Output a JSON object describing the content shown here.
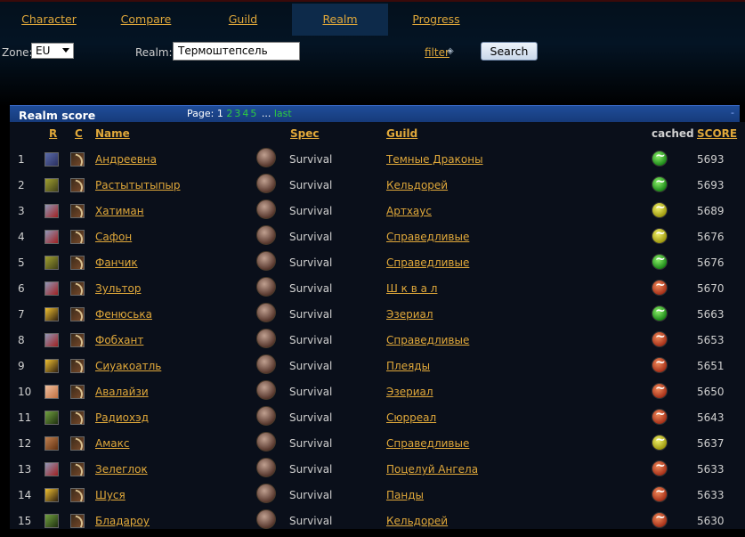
{
  "tabs": [
    {
      "label": "Character"
    },
    {
      "label": "Compare"
    },
    {
      "label": "Guild"
    },
    {
      "label": "Realm",
      "active": true
    },
    {
      "label": "Progress"
    }
  ],
  "search": {
    "zone_label": "Zone:",
    "zone_value": "EU",
    "realm_label": "Realm:",
    "realm_value": "Термоштепсель",
    "filter_label": "filter",
    "button_label": "Search"
  },
  "panel": {
    "title": "Realm score",
    "page_label": "Page:",
    "current_page": "1",
    "pages": [
      "2",
      "3",
      "4",
      "5"
    ],
    "ellipsis": "...",
    "last_label": "last",
    "collapse": "-"
  },
  "columns": {
    "r": "R",
    "c": "C",
    "name": "Name",
    "spec": "Spec",
    "guild": "Guild",
    "cached": "cached",
    "score": "SCORE"
  },
  "colors": {
    "link": "#e0a83a",
    "header_bar": "#1f4d99",
    "pager_link": "#2ecc40"
  },
  "rows": [
    {
      "rank": "1",
      "name": "Андреевна",
      "spec": "Survival",
      "guild": "Темные Драконы",
      "score": "5693",
      "race": "draenei",
      "cache": "green"
    },
    {
      "rank": "2",
      "name": "Растытытыпыр",
      "spec": "Survival",
      "guild": "Кельдорей",
      "score": "5693",
      "race": "nightelf",
      "cache": "green"
    },
    {
      "rank": "3",
      "name": "Хатиман",
      "spec": "Survival",
      "guild": "Артхаус",
      "score": "5689",
      "race": "human",
      "cache": "yellow"
    },
    {
      "rank": "4",
      "name": "Сафон",
      "spec": "Survival",
      "guild": "Справедливые",
      "score": "5676",
      "race": "human",
      "cache": "yellow"
    },
    {
      "rank": "5",
      "name": "Фанчик",
      "spec": "Survival",
      "guild": "Справедливые",
      "score": "5676",
      "race": "nightelf",
      "cache": "green"
    },
    {
      "rank": "6",
      "name": "Зультор",
      "spec": "Survival",
      "guild": "Ш к в а л",
      "score": "5670",
      "race": "human",
      "cache": "red"
    },
    {
      "rank": "7",
      "name": "Фенюська",
      "spec": "Survival",
      "guild": "Эзериал",
      "score": "5663",
      "race": "dwarf",
      "cache": "green"
    },
    {
      "rank": "8",
      "name": "Фобхант",
      "spec": "Survival",
      "guild": "Справедливые",
      "score": "5653",
      "race": "human",
      "cache": "red"
    },
    {
      "rank": "9",
      "name": "Сиуакоатль",
      "spec": "Survival",
      "guild": "Плеяды",
      "score": "5651",
      "race": "dwarf",
      "cache": "red"
    },
    {
      "rank": "10",
      "name": "Авалайзи",
      "spec": "Survival",
      "guild": "Эзериал",
      "score": "5650",
      "race": "gnome",
      "cache": "red"
    },
    {
      "rank": "11",
      "name": "Радиохэд",
      "spec": "Survival",
      "guild": "Сюрреал",
      "score": "5643",
      "race": "troll",
      "cache": "red"
    },
    {
      "rank": "12",
      "name": "Амакс",
      "spec": "Survival",
      "guild": "Справедливые",
      "score": "5637",
      "race": "orc",
      "cache": "yellow"
    },
    {
      "rank": "13",
      "name": "Зелеглок",
      "spec": "Survival",
      "guild": "Поцелуй Ангела",
      "score": "5633",
      "race": "human",
      "cache": "red"
    },
    {
      "rank": "14",
      "name": "Шуся",
      "spec": "Survival",
      "guild": "Панды",
      "score": "5633",
      "race": "dwarf",
      "cache": "red"
    },
    {
      "rank": "15",
      "name": "Бладароу",
      "spec": "Survival",
      "guild": "Кельдорей",
      "score": "5630",
      "race": "troll",
      "cache": "red"
    }
  ]
}
